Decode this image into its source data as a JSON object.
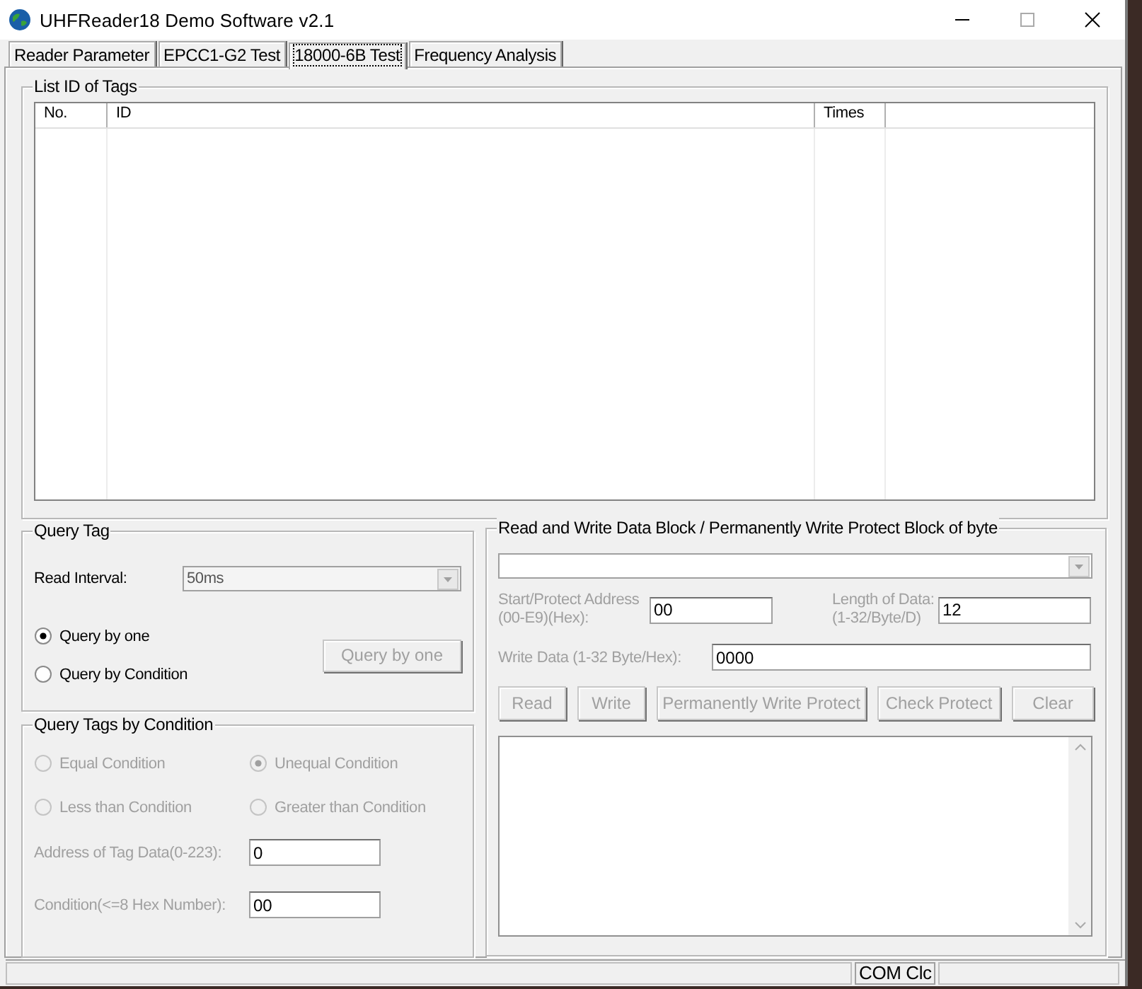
{
  "window": {
    "title": "UHFReader18 Demo Software v2.1"
  },
  "tabs": [
    {
      "label": "Reader Parameter",
      "selected": false
    },
    {
      "label": "EPCC1-G2 Test",
      "selected": false
    },
    {
      "label": "18000-6B Test",
      "selected": true
    },
    {
      "label": "Frequency Analysis",
      "selected": false
    }
  ],
  "tags_list": {
    "title": "List ID of Tags",
    "columns": [
      "No.",
      "ID",
      "Times"
    ]
  },
  "query_tag": {
    "title": "Query Tag",
    "read_interval": {
      "label": "Read Interval:",
      "value": "50ms"
    },
    "modes": [
      {
        "label": "Query by one",
        "selected": true
      },
      {
        "label": "Query by Condition",
        "selected": false
      }
    ],
    "button": {
      "label": "Query by one",
      "disabled": true
    }
  },
  "condition": {
    "title": "Query Tags by Condition",
    "disabled": true,
    "options": [
      {
        "label": "Equal Condition",
        "selected": false
      },
      {
        "label": "Unequal Condition",
        "selected": true
      },
      {
        "label": "Less than Condition",
        "selected": false
      },
      {
        "label": "Greater than Condition",
        "selected": false
      }
    ],
    "fields": [
      {
        "label": "Address of Tag Data(0-223):",
        "value": "0"
      },
      {
        "label": "Condition(<=8 Hex Number):",
        "value": "00"
      }
    ]
  },
  "data_block": {
    "title": "Read and Write Data Block / Permanently Write  Protect Block of  byte",
    "disabled": true,
    "start_address": {
      "label": "Start/Protect Address\n(00-E9)(Hex):",
      "value": "00"
    },
    "length": {
      "label": "Length of Data:\n(1-32/Byte/D)",
      "value": "12"
    },
    "write_data": {
      "label": "Write Data (1-32 Byte/Hex):",
      "value": "0000"
    },
    "buttons": [
      {
        "label": "Read",
        "disabled": true
      },
      {
        "label": "Write",
        "disabled": true
      },
      {
        "label": "Permanently Write  Protect",
        "disabled": true
      },
      {
        "label": "Check Protect",
        "disabled": true
      },
      {
        "label": "Clear",
        "disabled": true
      }
    ]
  },
  "status_bar": {
    "port": "COM Clc"
  }
}
